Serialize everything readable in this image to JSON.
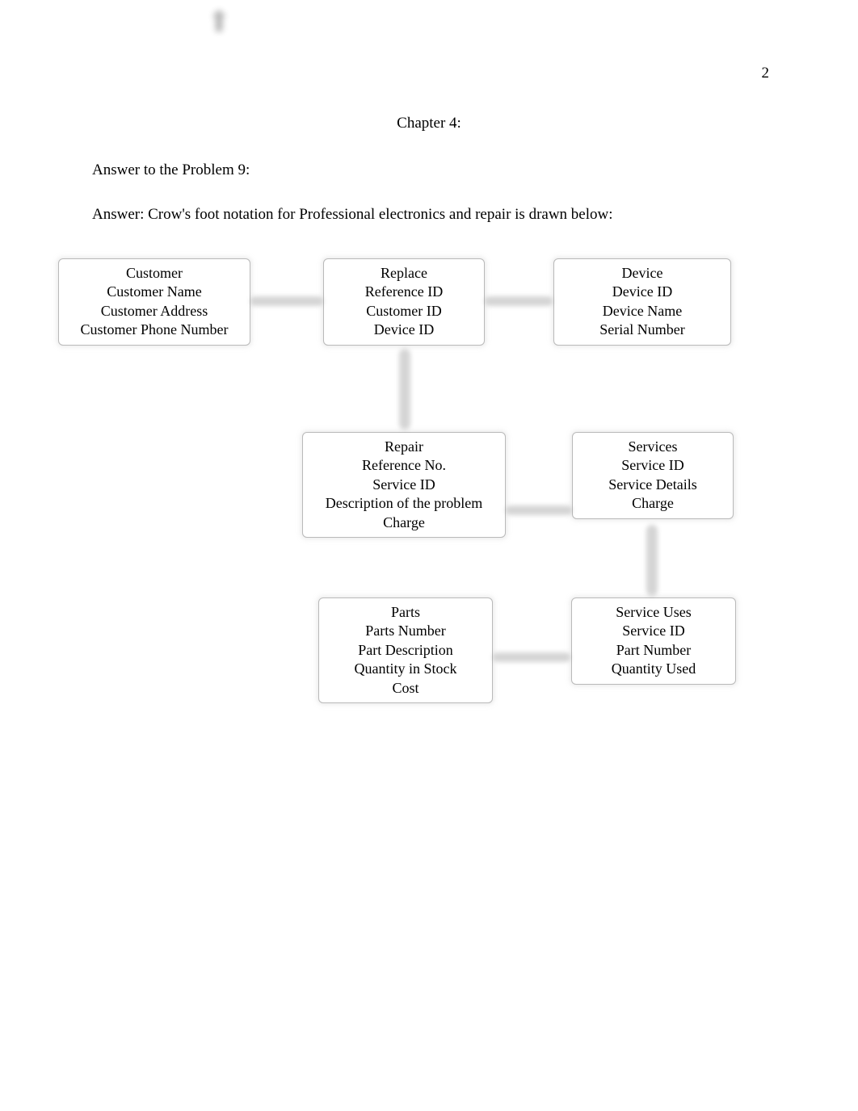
{
  "page_number": "2",
  "chapter_title": "Chapter 4:",
  "problem_heading": "Answer to the Problem 9:",
  "answer_intro": "Answer: Crow's foot notation for Professional electronics and repair is drawn below:",
  "entities": {
    "customer": {
      "title": "Customer",
      "attrs": [
        "Customer Name",
        "Customer Address",
        "Customer Phone Number"
      ]
    },
    "replace": {
      "title": "Replace",
      "attrs": [
        "Reference ID",
        "Customer ID",
        "Device ID"
      ]
    },
    "device": {
      "title": "Device",
      "attrs": [
        "Device ID",
        "Device Name",
        "Serial Number"
      ]
    },
    "repair": {
      "title": "Repair",
      "attrs": [
        "Reference No.",
        "Service ID",
        "Description of the problem",
        "Charge"
      ]
    },
    "services": {
      "title": "Services",
      "attrs": [
        "Service ID",
        "Service Details",
        "Charge"
      ]
    },
    "parts": {
      "title": "Parts",
      "attrs": [
        "Parts Number",
        "Part Description",
        "Quantity in Stock",
        "Cost"
      ]
    },
    "service_uses": {
      "title": "Service Uses",
      "attrs": [
        "Service ID",
        "Part Number",
        "Quantity Used"
      ]
    }
  },
  "relationships": [
    {
      "from": "customer",
      "to": "replace",
      "type": "one-to-many"
    },
    {
      "from": "replace",
      "to": "device",
      "type": "many-to-one"
    },
    {
      "from": "replace",
      "to": "repair",
      "type": "one-to-many"
    },
    {
      "from": "repair",
      "to": "services",
      "type": "many-to-one"
    },
    {
      "from": "services",
      "to": "service_uses",
      "type": "one-to-many"
    },
    {
      "from": "parts",
      "to": "service_uses",
      "type": "one-to-many"
    }
  ]
}
